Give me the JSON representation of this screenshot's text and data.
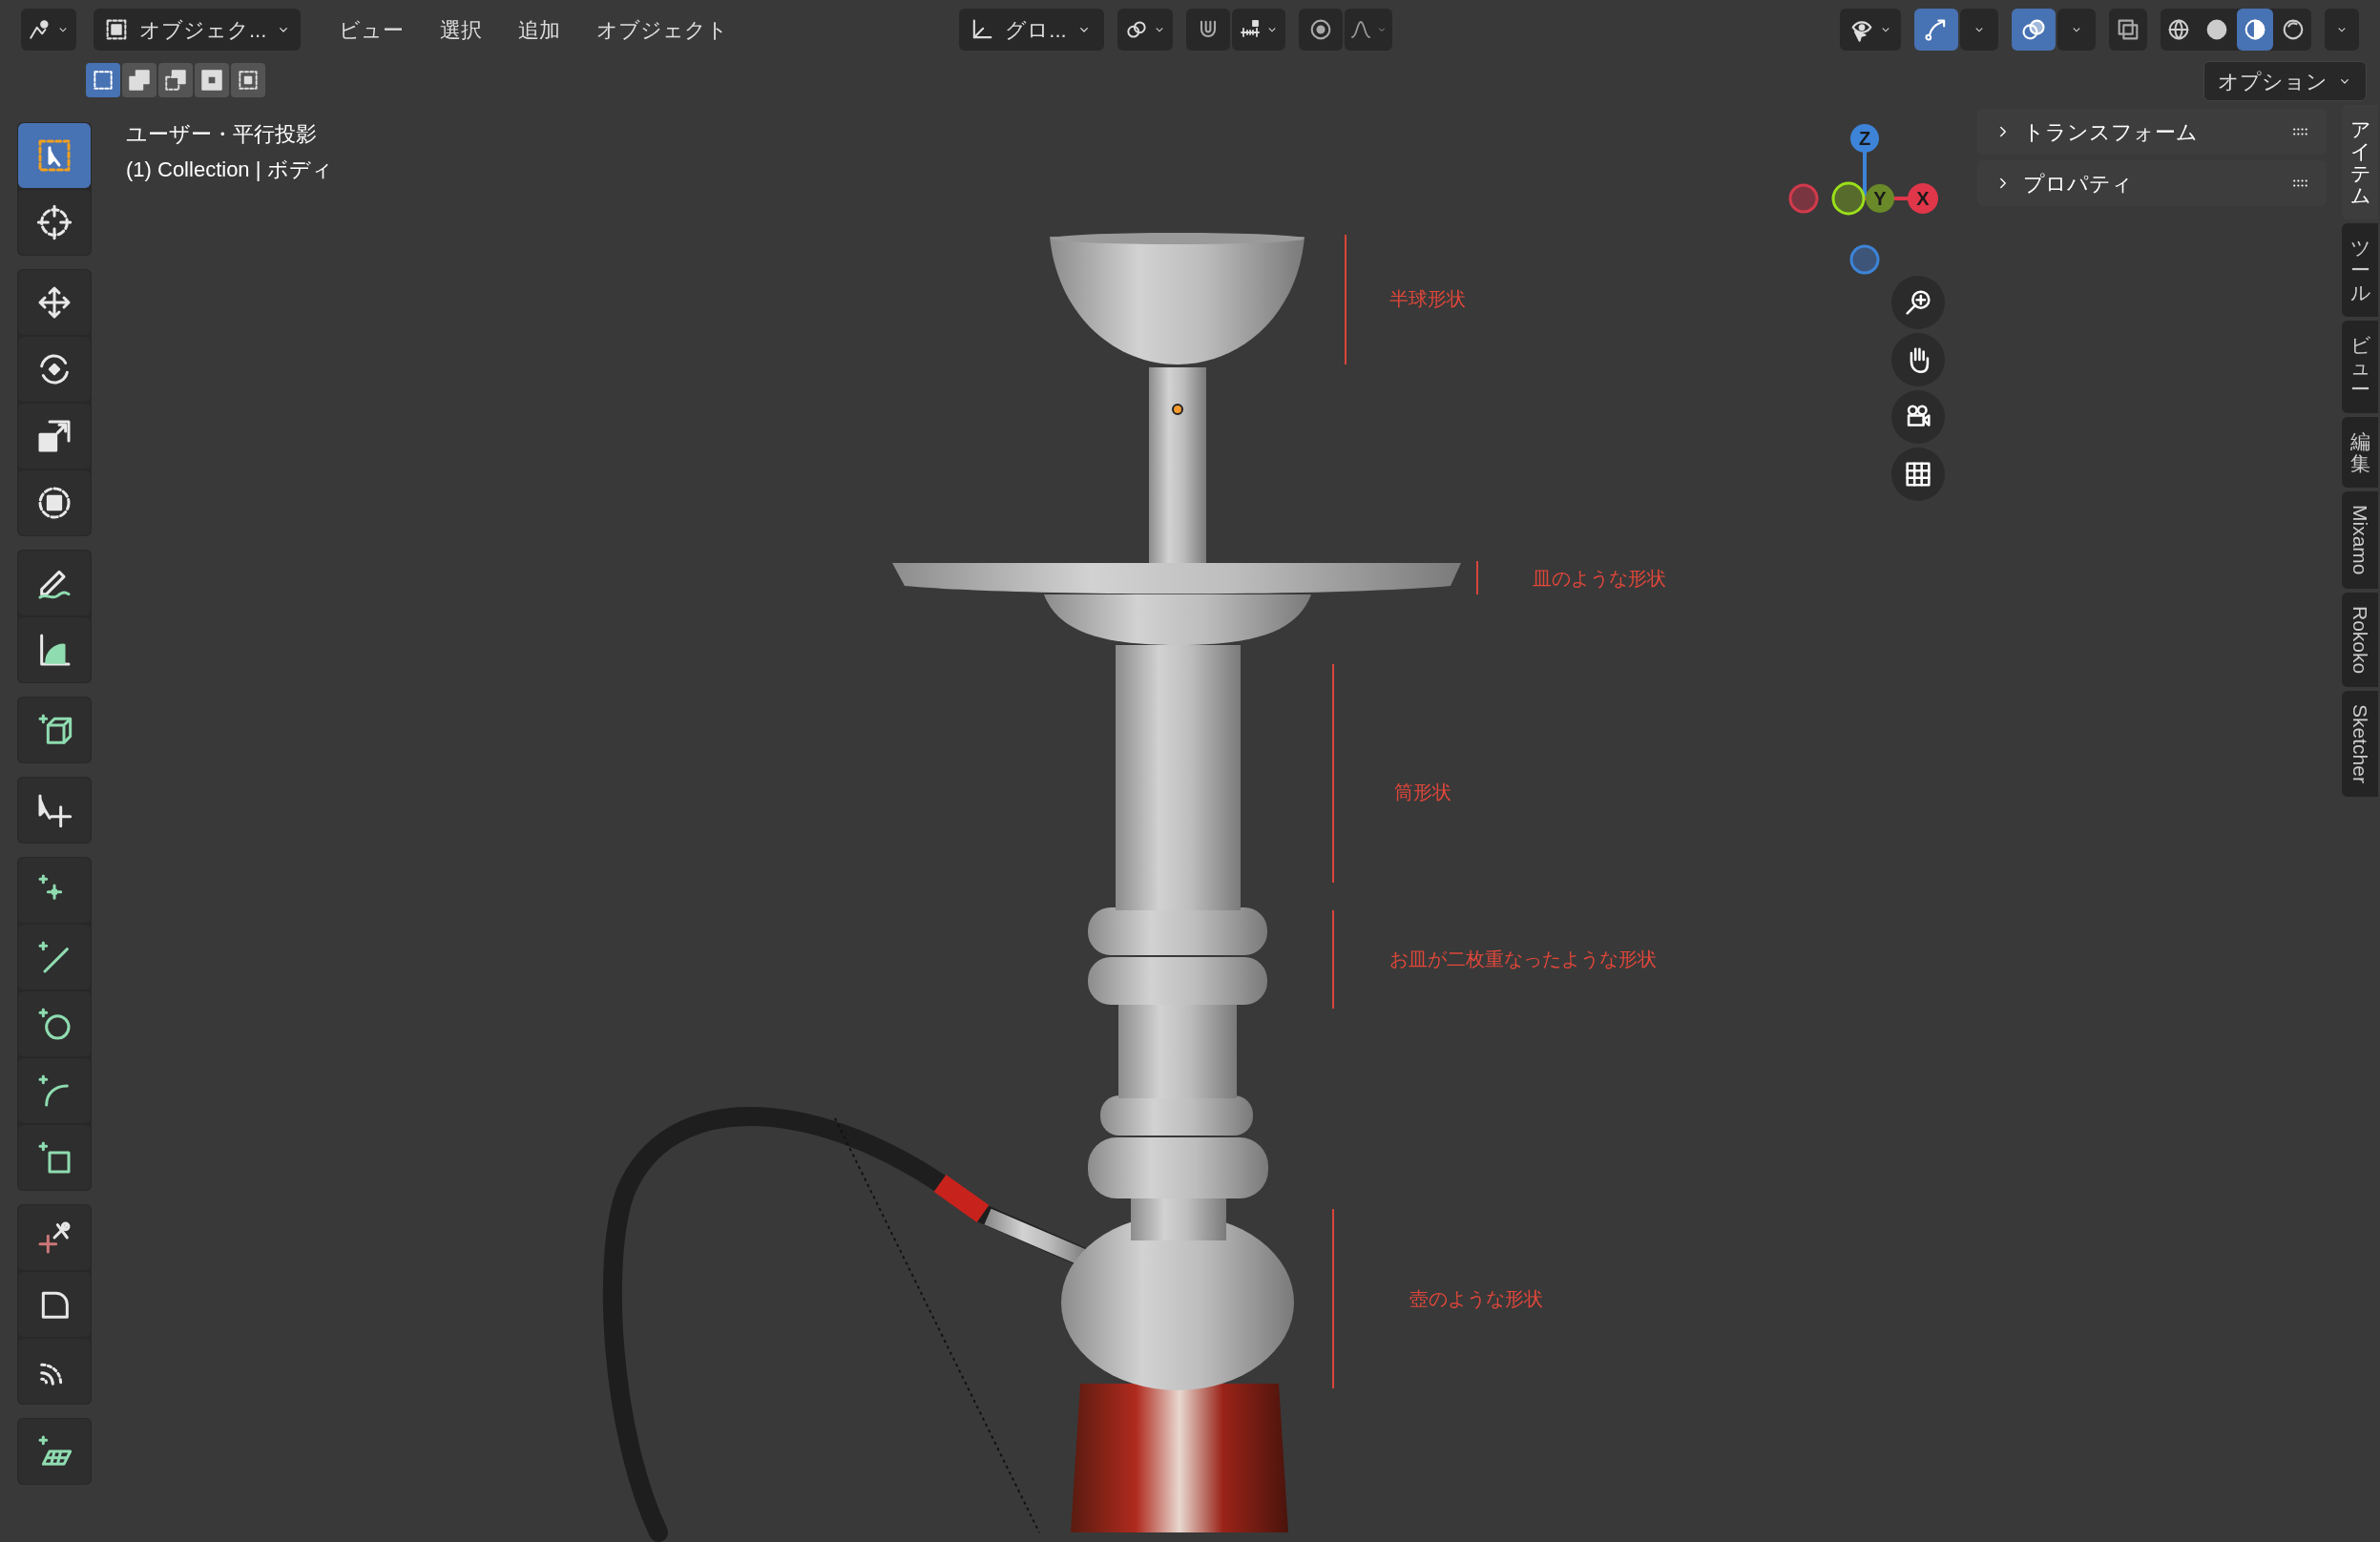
{
  "header": {
    "mode_dropdown": "オブジェク...",
    "menus": [
      "ビュー",
      "選択",
      "追加",
      "オブジェクト"
    ],
    "orientation_dropdown": "グロ...",
    "toggles": [
      {
        "kind": "snap",
        "on": false
      },
      {
        "kind": "proportional",
        "on": false
      },
      {
        "kind": "gizmo",
        "on": true
      },
      {
        "kind": "overlays",
        "on": true
      },
      {
        "kind": "xray",
        "on": false
      }
    ],
    "shading": [
      {
        "kind": "wireframe",
        "selected": false
      },
      {
        "kind": "solid",
        "selected": false
      },
      {
        "kind": "material",
        "selected": true
      },
      {
        "kind": "rendered",
        "selected": false
      }
    ],
    "select_modes": [
      {
        "selected": true
      },
      {
        "selected": false
      },
      {
        "selected": false
      },
      {
        "selected": false
      },
      {
        "selected": false
      }
    ],
    "options": "オプション"
  },
  "viewport": {
    "view_name": "ユーザー・平行投影",
    "object_info": "(1) Collection | ボディ",
    "annotations": [
      {
        "label": "半球形状"
      },
      {
        "label": "皿のような形状"
      },
      {
        "label": "筒形状"
      },
      {
        "label": "お皿が二枚重なったような形状"
      },
      {
        "label": "壺のような形状"
      }
    ],
    "gizmo_axes": [
      "Z",
      "Y",
      "X"
    ]
  },
  "toolbar": {
    "groups": [
      [
        {
          "kind": "select",
          "selected": true
        },
        {
          "kind": "cursor",
          "selected": false
        }
      ],
      [
        {
          "kind": "move",
          "selected": false
        },
        {
          "kind": "rotate",
          "selected": false
        },
        {
          "kind": "scale",
          "selected": false
        },
        {
          "kind": "transform",
          "selected": false
        }
      ],
      [
        {
          "kind": "annotate",
          "selected": false
        },
        {
          "kind": "measure",
          "selected": false
        }
      ],
      [
        {
          "kind": "add_cube",
          "selected": false
        }
      ],
      [
        {
          "kind": "select_move",
          "selected": false
        }
      ],
      [
        {
          "kind": "point",
          "selected": false
        },
        {
          "kind": "line",
          "selected": false
        },
        {
          "kind": "circle",
          "selected": false
        },
        {
          "kind": "arc",
          "selected": false
        },
        {
          "kind": "rectangle",
          "selected": false
        }
      ],
      [
        {
          "kind": "scissors",
          "selected": false
        },
        {
          "kind": "corner",
          "selected": false
        },
        {
          "kind": "arcs",
          "selected": false
        }
      ],
      [
        {
          "kind": "plane",
          "selected": false
        }
      ]
    ]
  },
  "sidebar": {
    "panels": [
      {
        "title": "トランスフォーム",
        "expanded": false
      },
      {
        "title": "プロパティ",
        "expanded": false
      }
    ],
    "tabs": [
      {
        "label": "アイテム",
        "kind": "stacked",
        "selected": true
      },
      {
        "label": "ツール",
        "kind": "stacked",
        "selected": false
      },
      {
        "label": "ビュー",
        "kind": "stacked",
        "selected": false
      },
      {
        "label": "編集",
        "kind": "stacked",
        "selected": false
      },
      {
        "label": "Mixamo",
        "kind": "rotated",
        "selected": false
      },
      {
        "label": "Rokoko",
        "kind": "rotated",
        "selected": false
      },
      {
        "label": "Sketcher",
        "kind": "rotated",
        "selected": false
      }
    ]
  }
}
